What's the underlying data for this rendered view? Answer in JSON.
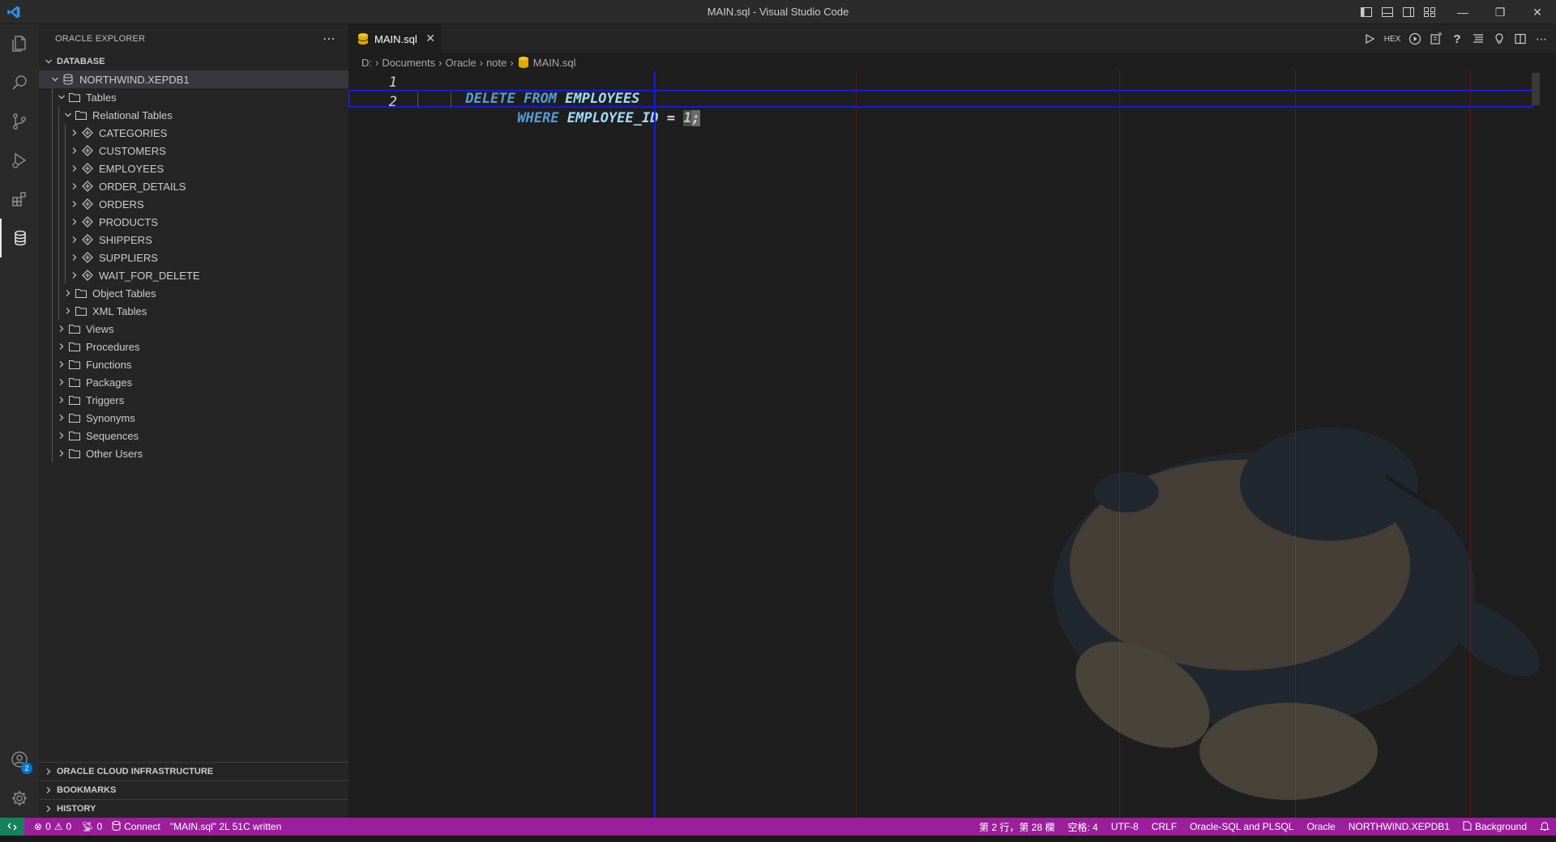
{
  "window": {
    "title": "MAIN.sql - Visual Studio Code"
  },
  "sidebar": {
    "title": "ORACLE EXPLORER",
    "section": "DATABASE",
    "connection": "NORTHWIND.XEPDB1",
    "tables_label": "Tables",
    "relational_label": "Relational Tables",
    "tables": [
      "CATEGORIES",
      "CUSTOMERS",
      "EMPLOYEES",
      "ORDER_DETAILS",
      "ORDERS",
      "PRODUCTS",
      "SHIPPERS",
      "SUPPLIERS",
      "WAIT_FOR_DELETE"
    ],
    "table_subfolders": [
      "Object Tables",
      "XML Tables"
    ],
    "folders": [
      "Views",
      "Procedures",
      "Functions",
      "Packages",
      "Triggers",
      "Synonyms",
      "Sequences",
      "Other Users"
    ],
    "bottom_sections": [
      "ORACLE CLOUD INFRASTRUCTURE",
      "BOOKMARKS",
      "HISTORY"
    ]
  },
  "editor": {
    "tab_label": "MAIN.sql",
    "breadcrumb": [
      "D:",
      "Documents",
      "Oracle",
      "note",
      "MAIN.sql"
    ],
    "hex_label": "HEX",
    "line_numbers": [
      "1",
      "2"
    ],
    "line1": {
      "kw1": "DELETE",
      "kw2": "FROM",
      "table": "EMPLOYEES"
    },
    "line2": {
      "kw": "WHERE",
      "column": "EMPLOYEE_ID",
      "op": "=",
      "value": "1",
      "semicolon": ";"
    }
  },
  "accounts_badge": "2",
  "statusbar": {
    "errors": "0",
    "warnings": "0",
    "ports": "0",
    "connect": "Connect",
    "message": "\"MAIN.sql\" 2L 51C written",
    "position": "第 2 行，第 28 欄",
    "spaces": "空格: 4",
    "encoding": "UTF-8",
    "eol": "CRLF",
    "language": "Oracle-SQL and PLSQL",
    "oracle": "Oracle",
    "db": "NORTHWIND.XEPDB1",
    "background": "Background"
  },
  "colors": {
    "statusbar": "#9b1f9b",
    "remote": "#16825d",
    "keyword": "#569cd6",
    "identifier": "#9cdcfe",
    "line_highlight_border": "#1a1ad6"
  }
}
